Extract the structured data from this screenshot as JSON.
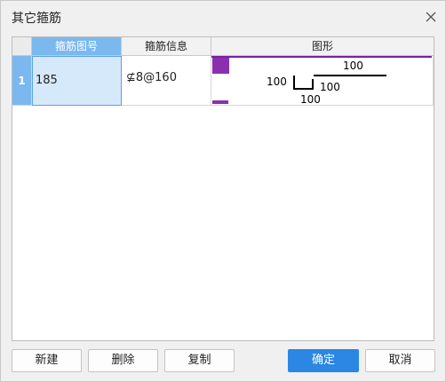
{
  "window": {
    "title": "其它箍筋"
  },
  "table": {
    "columns": [
      "箍筋图号",
      "箍筋信息",
      "图形"
    ],
    "rows": [
      {
        "row_number": "1",
        "shape_number": "185",
        "rebar_info": "⊈8@160",
        "figure": {
          "dim_top": "100",
          "dim_left": "100",
          "dim_right": "100",
          "dim_bottom": "100"
        }
      }
    ]
  },
  "buttons": {
    "new": "新建",
    "delete": "删除",
    "copy": "复制",
    "ok": "确定",
    "cancel": "取消"
  },
  "colors": {
    "accent": "#2b86e4",
    "selected_header": "#7ab8ef",
    "selected_cell": "#d6e9fb",
    "artifact": "#7b1fa2"
  }
}
